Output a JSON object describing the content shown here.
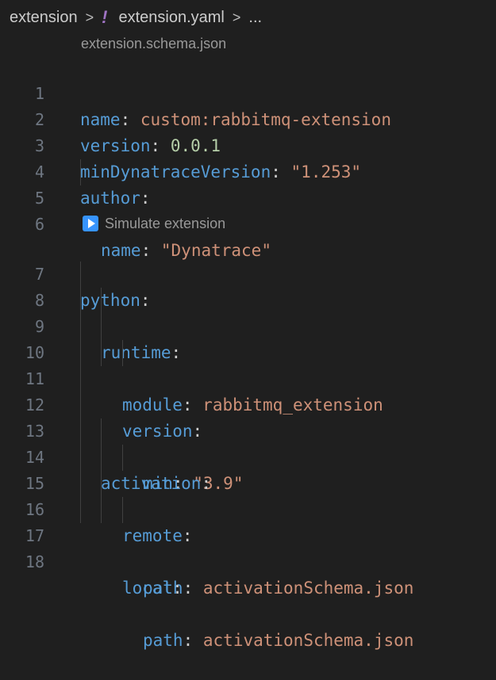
{
  "breadcrumb": {
    "folder": "extension",
    "sep1": ">",
    "file_icon": "!",
    "file": "extension.yaml",
    "sep2": ">",
    "more": "..."
  },
  "codelens": {
    "schema": "extension.schema.json",
    "simulate": "Simulate extension",
    "simulate_icon": "play-icon"
  },
  "lines": [
    {
      "n": "1",
      "key": "name",
      "colon": ":",
      "val": "custom:rabbitmq-extension"
    },
    {
      "n": "2",
      "key": "version",
      "colon": ":",
      "val": "0.0.1"
    },
    {
      "n": "3",
      "key": "minDynatraceVersion",
      "colon": ":",
      "val": "\"1.253\""
    },
    {
      "n": "4",
      "key": "author",
      "colon": ":"
    },
    {
      "n": "5",
      "key": "name",
      "colon": ":",
      "val": "\"Dynatrace\""
    },
    {
      "n": "6"
    },
    {
      "n": "7",
      "key": "python",
      "colon": ":"
    },
    {
      "n": "8",
      "key": "runtime",
      "colon": ":"
    },
    {
      "n": "9",
      "key": "module",
      "colon": ":",
      "val": "rabbitmq_extension"
    },
    {
      "n": "10",
      "key": "version",
      "colon": ":"
    },
    {
      "n": "11",
      "key": "min",
      "colon": ":",
      "val": "\"3.9\""
    },
    {
      "n": "12"
    },
    {
      "n": "13",
      "key": "activation",
      "colon": ":"
    },
    {
      "n": "14",
      "key": "remote",
      "colon": ":"
    },
    {
      "n": "15",
      "key": "path",
      "colon": ":",
      "val": "activationSchema.json"
    },
    {
      "n": "16",
      "key": "local",
      "colon": ":"
    },
    {
      "n": "17",
      "key": "path",
      "colon": ":",
      "val": "activationSchema.json"
    },
    {
      "n": "18"
    }
  ],
  "colors": {
    "background": "#1f1f1f",
    "key": "#569cd6",
    "string": "#ce9178",
    "number": "#b5cea8",
    "line_number": "#6e7681"
  }
}
